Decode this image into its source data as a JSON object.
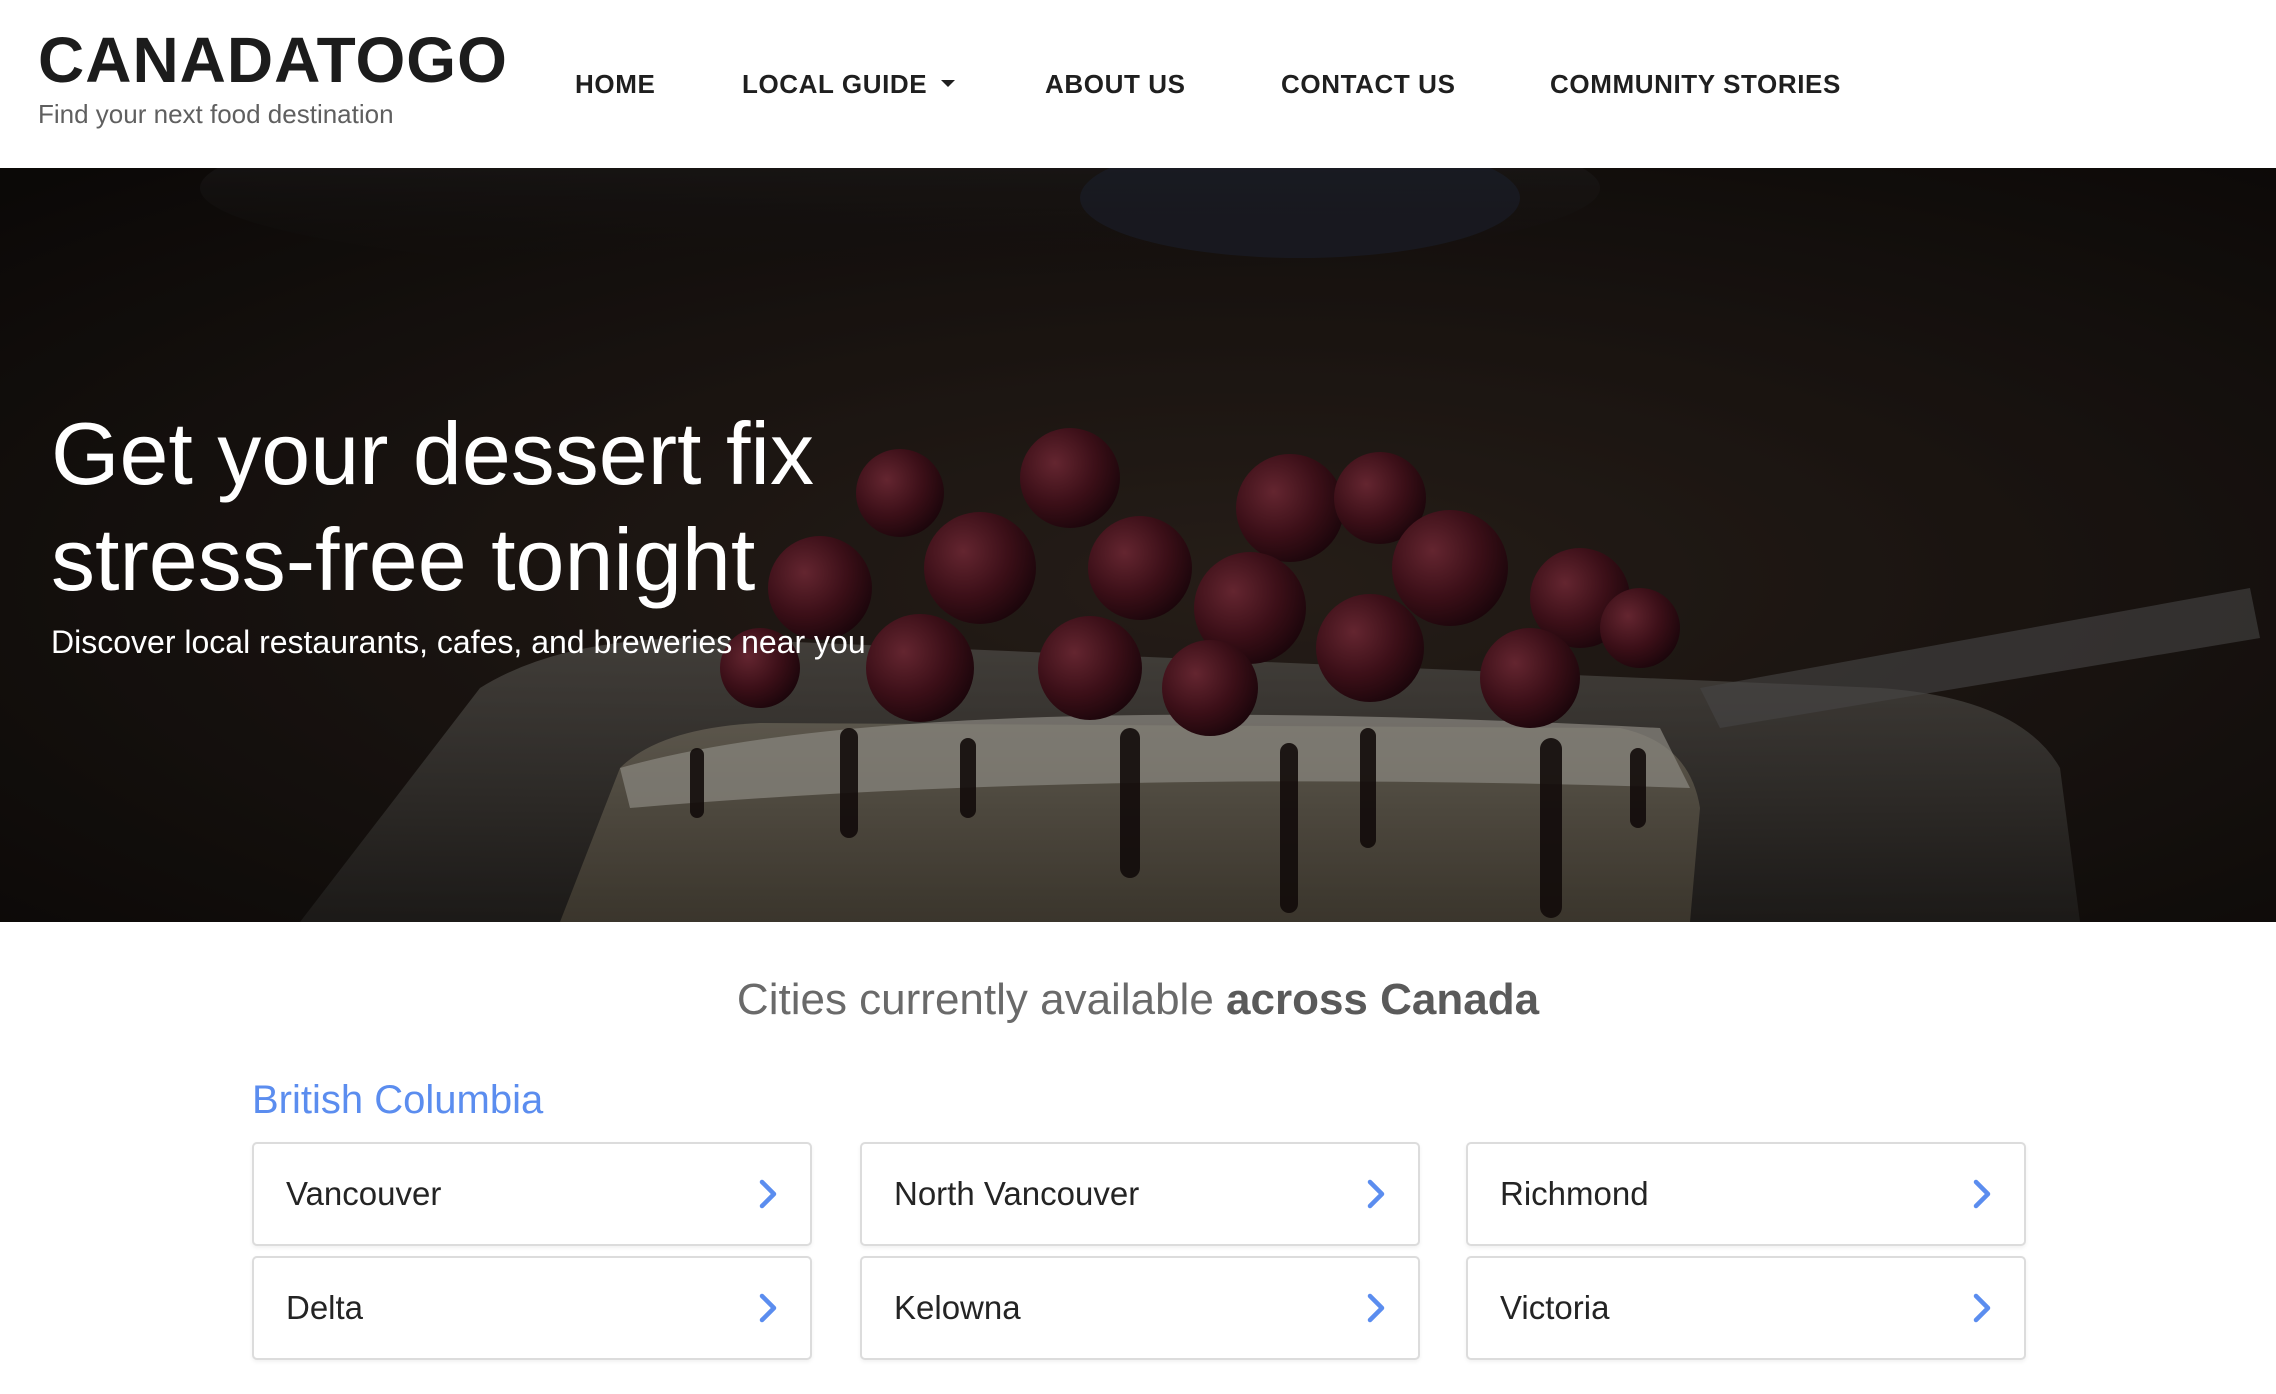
{
  "brand": {
    "title": "CANADATOGO",
    "tagline": "Find your next food destination"
  },
  "nav": {
    "home": "HOME",
    "local_guide": "LOCAL GUIDE",
    "about_us": "ABOUT US",
    "contact_us": "CONTACT US",
    "community_stories": "COMMUNITY STORIES"
  },
  "hero": {
    "title_line1": "Get your dessert fix",
    "title_line2": "stress-free tonight",
    "subtitle": "Discover local restaurants, cafes, and breweries near you",
    "image_description_icon": "dessert-photo"
  },
  "cities": {
    "heading_prefix": "Cities currently available ",
    "heading_bold": "across Canada",
    "province": "British Columbia",
    "items": [
      {
        "name": "Vancouver"
      },
      {
        "name": "North Vancouver"
      },
      {
        "name": "Richmond"
      },
      {
        "name": "Delta"
      },
      {
        "name": "Kelowna"
      },
      {
        "name": "Victoria"
      }
    ],
    "chevron_icon": "chevron-right-icon"
  },
  "colors": {
    "accent": "#5b8def",
    "text_dark": "#1f1f1f",
    "heading_gray": "#6a6a6a"
  }
}
